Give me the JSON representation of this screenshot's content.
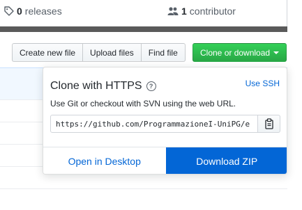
{
  "summary": {
    "releases_count": "0",
    "releases_label": "releases",
    "contributors_count": "1",
    "contributors_label": "contributor"
  },
  "toolbar": {
    "create_file_label": "Create new file",
    "upload_files_label": "Upload files",
    "find_file_label": "Find file",
    "clone_label": "Clone or download"
  },
  "clone_popover": {
    "title": "Clone with HTTPS",
    "help_icon": "question-circle-icon",
    "use_ssh_label": "Use SSH",
    "description": "Use Git or checkout with SVN using the web URL.",
    "url": "https://github.com/ProgrammazioneI-UniPG/e",
    "copy_icon": "clipboard-icon",
    "open_desktop_label": "Open in Desktop",
    "download_zip_label": "Download ZIP"
  },
  "colors": {
    "clone_button": "#28a745",
    "download_zip": "#0366d6",
    "link": "#0366d6",
    "dark_bar": "#5a5a5a"
  }
}
